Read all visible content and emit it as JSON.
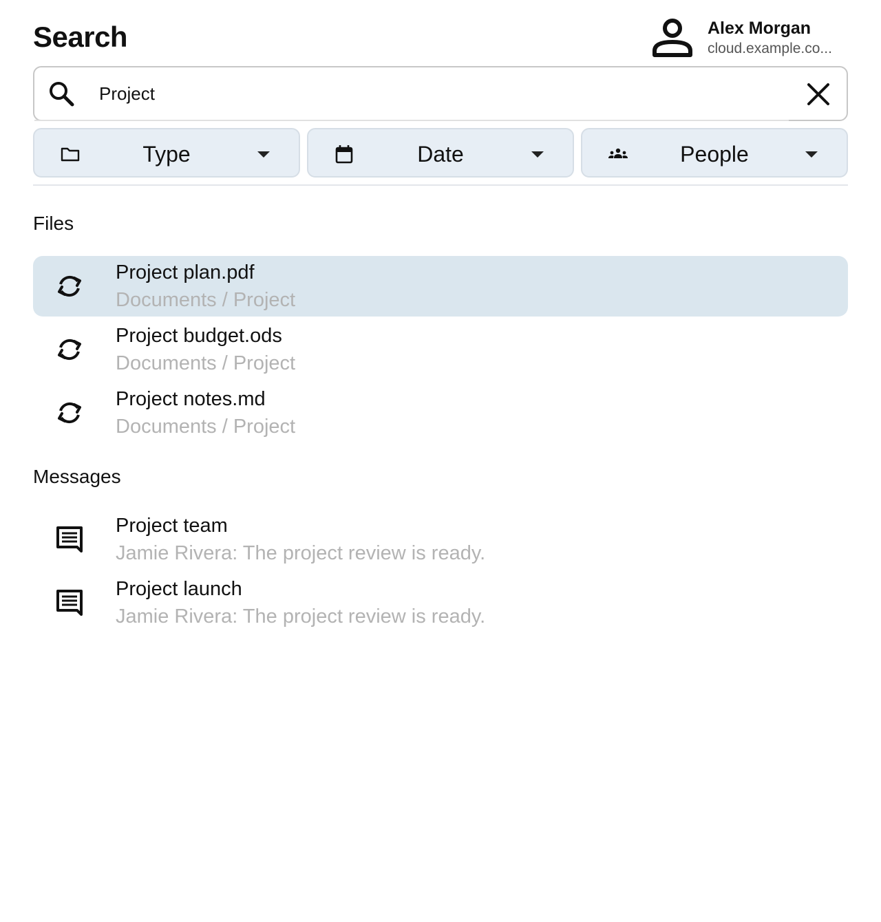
{
  "header": {
    "title": "Search",
    "account": {
      "name": "Alex Morgan",
      "server": "cloud.example.co..."
    }
  },
  "search": {
    "value": "Project",
    "placeholder": ""
  },
  "filters": [
    {
      "label": "Type",
      "icon": "folder-icon"
    },
    {
      "label": "Date",
      "icon": "calendar-icon"
    },
    {
      "label": "People",
      "icon": "people-icon"
    }
  ],
  "sections": {
    "files": {
      "title": "Files",
      "items": [
        {
          "title": "Project plan.pdf",
          "subtitle": "Documents / Project",
          "icon": "sync-icon",
          "selected": true
        },
        {
          "title": "Project budget.ods",
          "subtitle": "Documents / Project",
          "icon": "sync-icon",
          "selected": false
        },
        {
          "title": "Project notes.md",
          "subtitle": "Documents / Project",
          "icon": "sync-icon",
          "selected": false
        }
      ]
    },
    "messages": {
      "title": "Messages",
      "items": [
        {
          "title": "Project team",
          "subtitle": "Jamie Rivera: The project review is ready.",
          "icon": "chat-icon"
        },
        {
          "title": "Project launch",
          "subtitle": "Jamie Rivera: The project review is ready.",
          "icon": "chat-icon"
        }
      ]
    }
  },
  "colors": {
    "selected_row": "#dae6ee",
    "filter_bg": "#e7eef5",
    "subtitle": "#b3b3b3"
  }
}
